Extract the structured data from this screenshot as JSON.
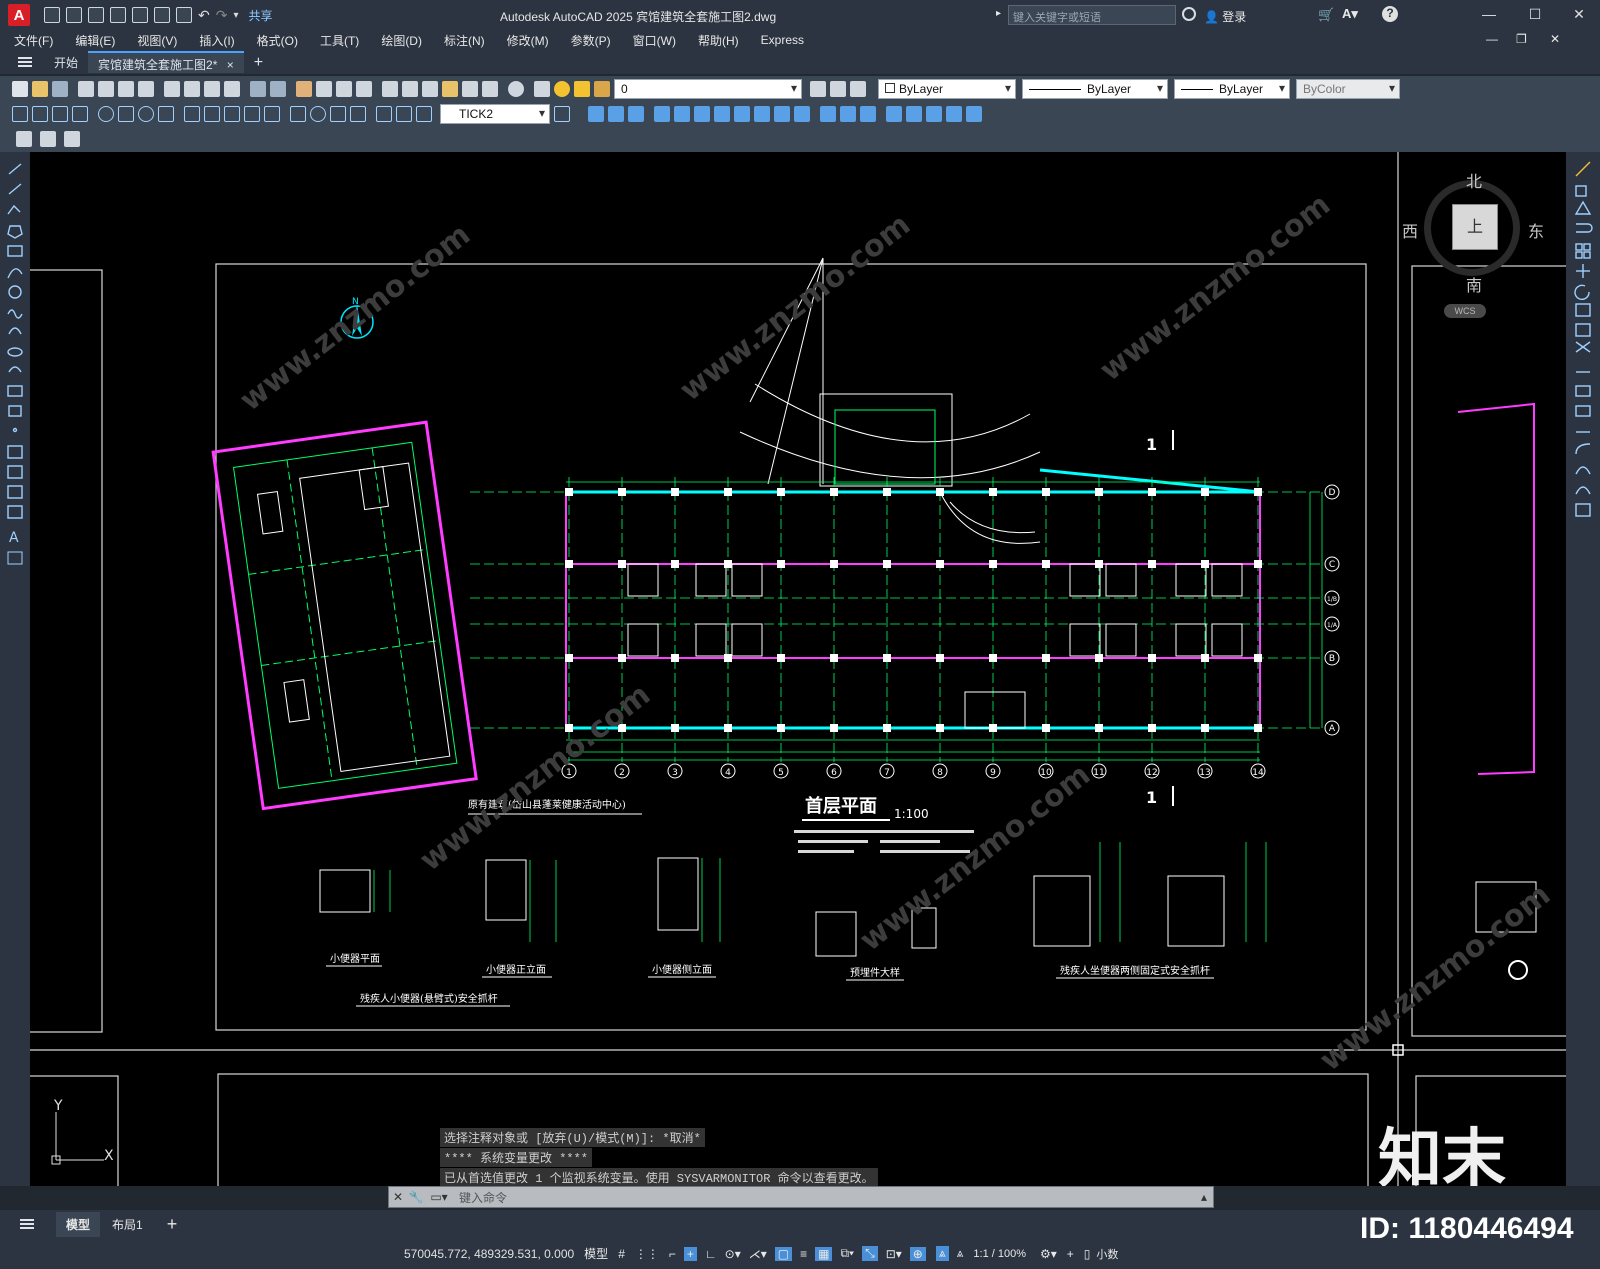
{
  "titlebar": {
    "app_logo": "A",
    "share_label": "共享",
    "title": "Autodesk AutoCAD 2025    宾馆建筑全套施工图2.dwg",
    "search_placeholder": "键入关键字或短语",
    "login_label": "登录"
  },
  "menu": [
    "文件(F)",
    "编辑(E)",
    "视图(V)",
    "插入(I)",
    "格式(O)",
    "工具(T)",
    "绘图(D)",
    "标注(N)",
    "修改(M)",
    "参数(P)",
    "窗口(W)",
    "帮助(H)",
    "Express"
  ],
  "tabs": {
    "start": "开始",
    "document": "宾馆建筑全套施工图2*",
    "close": "×",
    "add": "+"
  },
  "layer_toolbar": {
    "layer_value": "0",
    "color": "ByLayer",
    "linetype": "ByLayer",
    "lineweight": "ByLayer",
    "plotstyle": "ByColor"
  },
  "dim_toolbar": {
    "dim_style": "TICK2"
  },
  "viewcube": {
    "north": "北",
    "south": "南",
    "west": "西",
    "east": "东",
    "face": "上",
    "wcs": "WCS"
  },
  "drawing": {
    "plan_title": "首层平面",
    "plan_scale": "1:100",
    "existing_building": "原有建筑(岱山县蓬莱健康活动中心)",
    "section_mark": "1",
    "detail_labels": [
      "小便器平面",
      "小便器正立面",
      "小便器侧立面",
      "预埋件大样",
      "残疾人坐便器两侧固定式安全抓杆",
      "残疾人小便器(悬臂式)安全抓杆"
    ],
    "axis_numbers": [
      "1",
      "2",
      "3",
      "4",
      "5",
      "6",
      "7",
      "8",
      "9",
      "10",
      "11",
      "12",
      "13",
      "14"
    ],
    "axis_letters": [
      "D",
      "C",
      "1/B",
      "1/A",
      "B",
      "A"
    ]
  },
  "ucs": {
    "y": "Y",
    "x": "X"
  },
  "command": {
    "history": [
      "选择注释对象或 [放弃(U)/模式(M)]: *取消*",
      "**** 系统变量更改 ****",
      "已从首选值更改 1 个监视系统变量。使用 SYSVARMONITOR 命令以查看更改。"
    ],
    "input_placeholder": "键入命令"
  },
  "layouts": {
    "model": "模型",
    "layout1": "布局1",
    "add": "+"
  },
  "status": {
    "coords": "570045.772, 489329.531, 0.000",
    "mode": "模型",
    "scale": "1:1 / 100%",
    "units": "小数"
  },
  "watermark": {
    "logo": "知末",
    "id": "ID: 1180446494"
  }
}
